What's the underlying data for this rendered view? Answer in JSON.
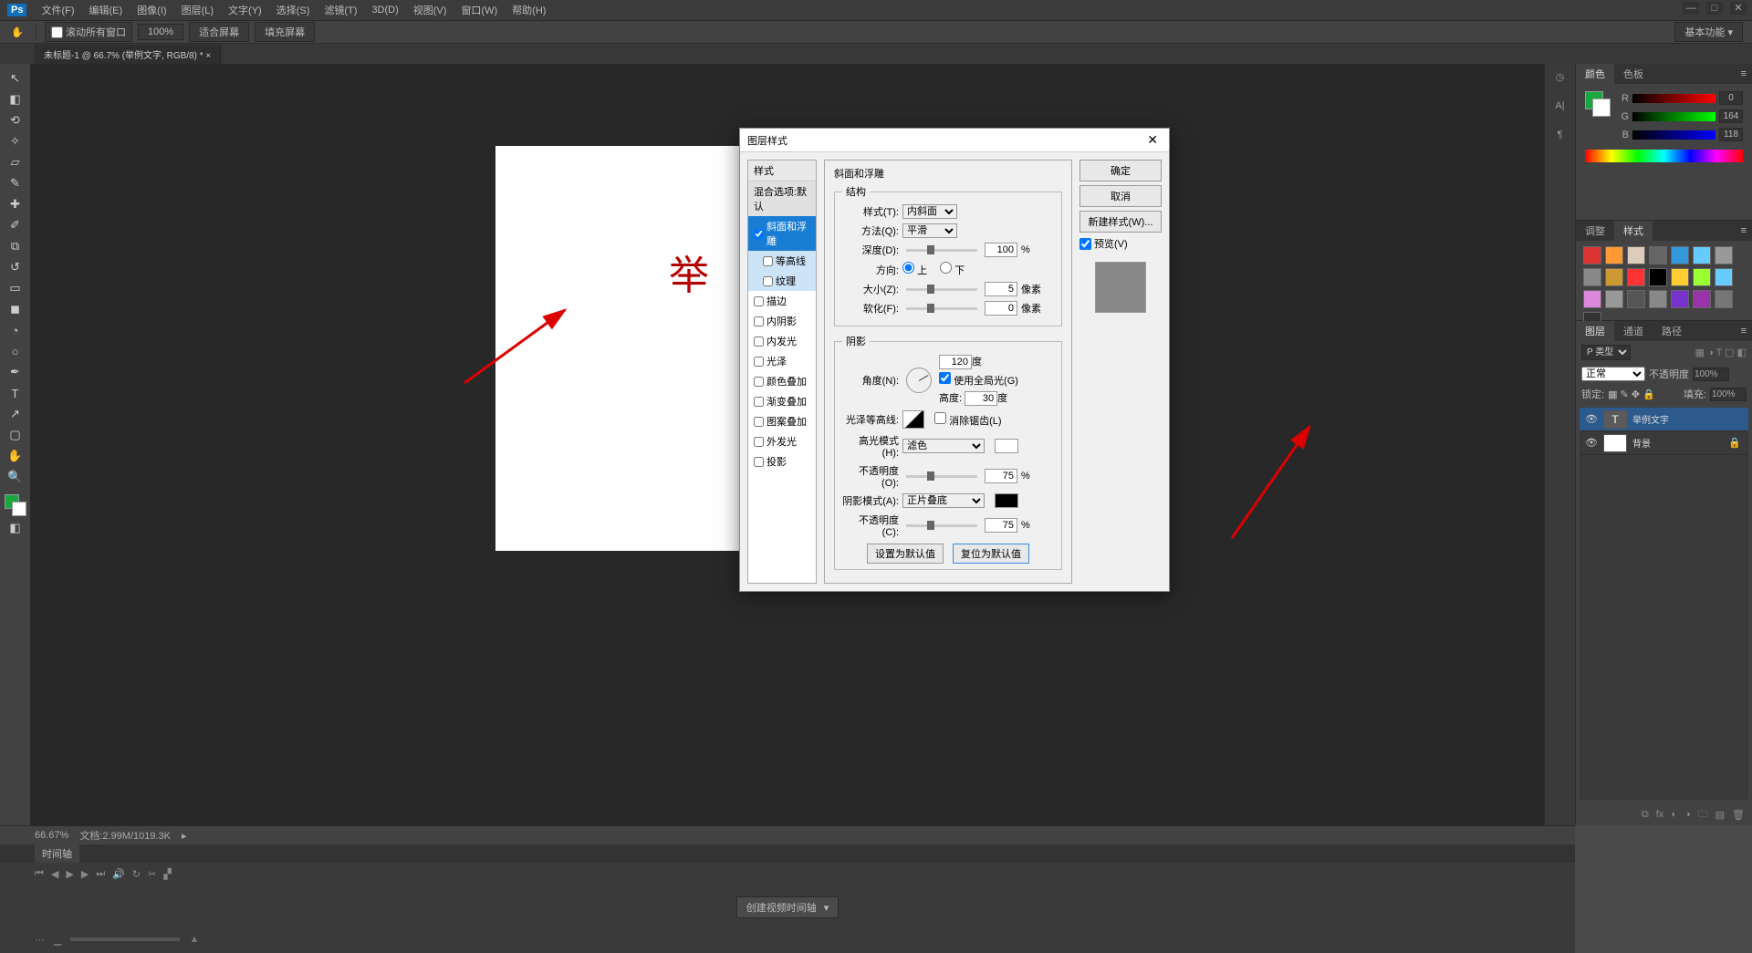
{
  "app": {
    "logo": "Ps"
  },
  "menu": [
    "文件(F)",
    "编辑(E)",
    "图像(I)",
    "图层(L)",
    "文字(Y)",
    "选择(S)",
    "滤镜(T)",
    "3D(D)",
    "视图(V)",
    "窗口(W)",
    "帮助(H)"
  ],
  "optbar": {
    "scroll_all": "滚动所有窗口",
    "zoom": "100%",
    "fit": "适合屏幕",
    "fill": "填充屏幕",
    "workspace": "基本功能"
  },
  "tab": {
    "title": "未标题-1 @ 66.7% (举例文字, RGB/8) * ×"
  },
  "canvas": {
    "text": "举 例 文 字"
  },
  "status": {
    "zoom": "66.67%",
    "doc": "文档:2.99M/1019.3K"
  },
  "timeline": {
    "tab": "时间轴",
    "create": "创建视频时间轴"
  },
  "color_panel": {
    "tabs": [
      "颜色",
      "色板"
    ],
    "r": "0",
    "g": "164",
    "b": "118"
  },
  "styles_panel": {
    "tabs": [
      "调整",
      "样式"
    ]
  },
  "swatch_colors": [
    "#d33",
    "#f93",
    "#dcb",
    "#666",
    "#39d",
    "#6cf",
    "#999",
    "#888",
    "#c93",
    "#f33",
    "#000",
    "#fc3",
    "#9f3",
    "#6cf",
    "#d8d",
    "#999",
    "#555",
    "#888",
    "#73c",
    "#93a",
    "#777",
    "#333"
  ],
  "layers_panel": {
    "tabs": [
      "图层",
      "通道",
      "路径"
    ],
    "type": "P 类型",
    "blend": "正常",
    "opacity_l": "不透明度",
    "opacity": "100%",
    "lock_l": "锁定:",
    "fill_l": "填充:",
    "fill": "100%",
    "layers": [
      {
        "name": "举例文字",
        "type": "T",
        "sel": true
      },
      {
        "name": "背景",
        "type": "bg",
        "sel": false,
        "locked": true
      }
    ]
  },
  "dialog": {
    "title": "图层样式",
    "style_list_header": "样式",
    "blend_opts": "混合选项:默认",
    "items": [
      {
        "label": "斜面和浮雕",
        "checked": true,
        "sel": true
      },
      {
        "label": "等高线",
        "checked": false,
        "sub": true
      },
      {
        "label": "纹理",
        "checked": false,
        "sub": true
      },
      {
        "label": "描边",
        "checked": false
      },
      {
        "label": "内阴影",
        "checked": false
      },
      {
        "label": "内发光",
        "checked": false
      },
      {
        "label": "光泽",
        "checked": false
      },
      {
        "label": "颜色叠加",
        "checked": false
      },
      {
        "label": "渐变叠加",
        "checked": false
      },
      {
        "label": "图案叠加",
        "checked": false
      },
      {
        "label": "外发光",
        "checked": false
      },
      {
        "label": "投影",
        "checked": false
      }
    ],
    "section_title": "斜面和浮雕",
    "group_structure": "结构",
    "style_l": "样式(T):",
    "style_v": "内斜面",
    "method_l": "方法(Q):",
    "method_v": "平滑",
    "depth_l": "深度(D):",
    "depth_v": "100",
    "depth_u": "%",
    "dir_l": "方向:",
    "dir_up": "上",
    "dir_dn": "下",
    "size_l": "大小(Z):",
    "size_v": "5",
    "size_u": "像素",
    "soften_l": "软化(F):",
    "soften_v": "0",
    "soften_u": "像素",
    "group_shadow": "阴影",
    "angle_l": "角度(N):",
    "angle_v": "120",
    "angle_u": "度",
    "global_l": "使用全局光(G)",
    "alt_l": "高度:",
    "alt_v": "30",
    "alt_u": "度",
    "gloss_l": "光泽等高线:",
    "anti_l": "消除锯齿(L)",
    "hl_mode_l": "高光模式(H):",
    "hl_mode_v": "滤色",
    "hl_op_l": "不透明度(O):",
    "hl_op_v": "75",
    "hl_op_u": "%",
    "sh_mode_l": "阴影模式(A):",
    "sh_mode_v": "正片叠底",
    "sh_op_l": "不透明度(C):",
    "sh_op_v": "75",
    "sh_op_u": "%",
    "make_default": "设置为默认值",
    "reset_default": "复位为默认值",
    "ok": "确定",
    "cancel": "取消",
    "new_style": "新建样式(W)...",
    "preview": "预览(V)"
  }
}
